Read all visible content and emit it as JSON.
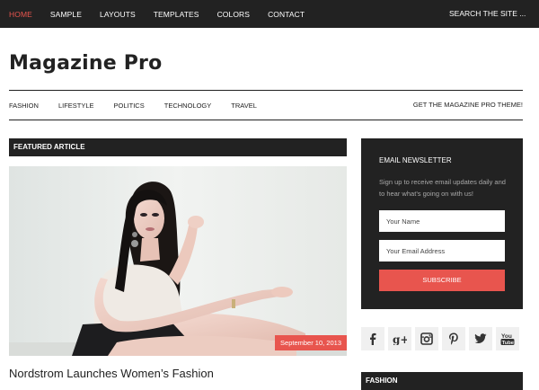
{
  "topnav": {
    "items": [
      "HOME",
      "SAMPLE",
      "LAYOUTS",
      "TEMPLATES",
      "COLORS",
      "CONTACT"
    ],
    "active_index": 0,
    "search_placeholder": "SEARCH THE SITE ..."
  },
  "site": {
    "title": "Magazine Pro"
  },
  "secondary_nav": {
    "items": [
      "FASHION",
      "LIFESTYLE",
      "POLITICS",
      "TECHNOLOGY",
      "TRAVEL"
    ],
    "promo": "GET THE MAGAZINE PRO THEME!"
  },
  "featured": {
    "heading": "FEATURED ARTICLE",
    "date": "September 10, 2013",
    "title": "Nordstrom Launches Women’s Fashion"
  },
  "newsletter": {
    "title": "EMAIL NEWSLETTER",
    "description": "Sign up to receive email updates daily and to hear what’s going on with us!",
    "name_placeholder": "Your Name",
    "email_placeholder": "Your Email Address",
    "button": "SUBSCRIBE"
  },
  "social": {
    "icons": [
      "facebook-icon",
      "google-plus-icon",
      "instagram-icon",
      "pinterest-icon",
      "twitter-icon",
      "youtube-icon"
    ]
  },
  "sidebar_section": {
    "heading": "FASHION"
  },
  "colors": {
    "accent": "#e8554e",
    "dark": "#222222",
    "social_bg": "#f0f0f0"
  }
}
